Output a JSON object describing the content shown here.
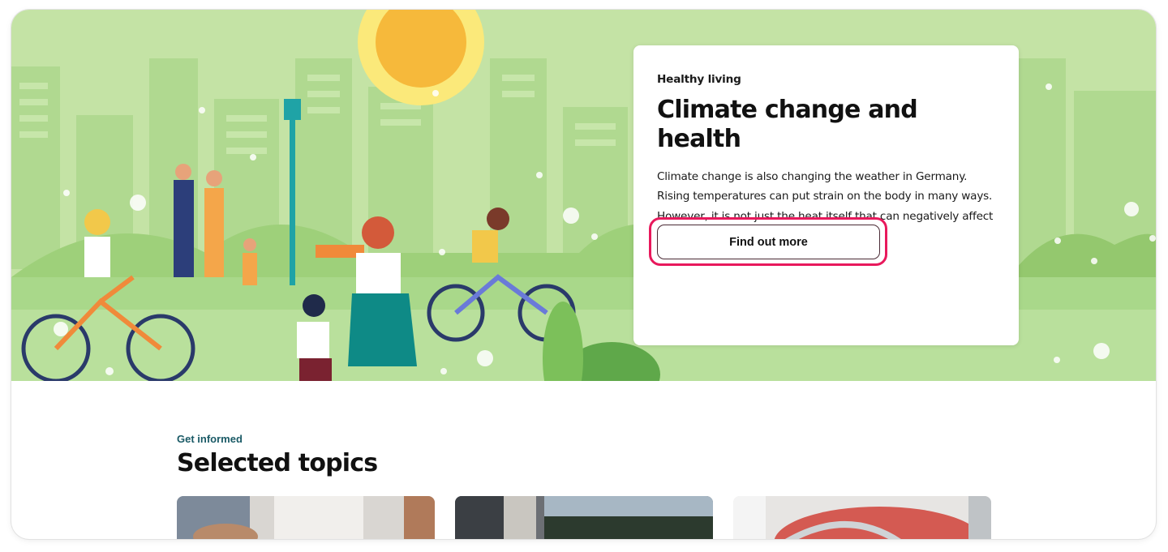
{
  "hero": {
    "eyebrow": "Healthy living",
    "title": "Climate change and health",
    "body": "Climate change is also changing the weather in Germany. Rising temperatures can put strain on the body in many ways. However, it is not just the heat itself that can negatively affect people’s health.",
    "cta_label": "Find out more"
  },
  "topics": {
    "eyebrow": "Get informed",
    "title": "Selected topics"
  },
  "colors": {
    "hero_bg": "#c4e3a5",
    "accent_teal": "#1a5a66",
    "focus_ring": "#e8195c",
    "sun": "#f6b93b"
  }
}
